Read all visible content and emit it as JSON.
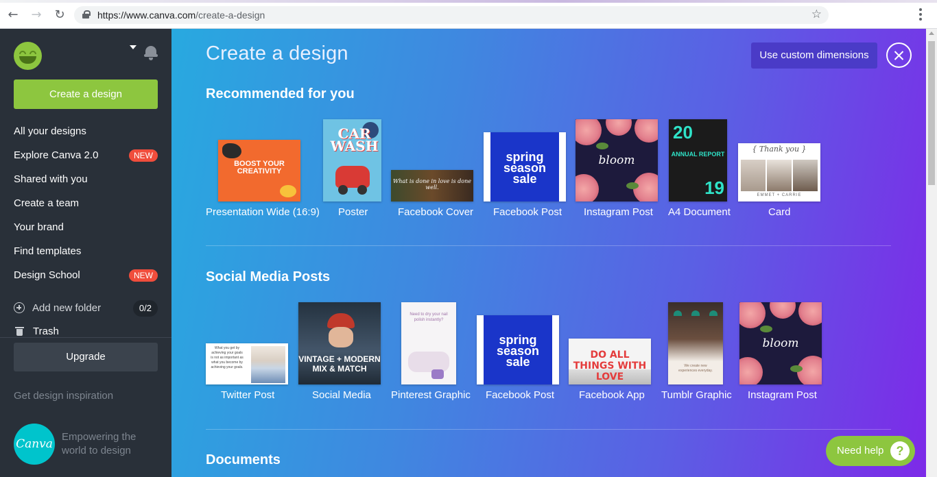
{
  "browser": {
    "url_host": "https://www.canva.com",
    "url_path": "/create-a-design",
    "back_icon": "arrow-left-icon",
    "forward_icon": "arrow-right-icon",
    "reload_icon": "reload-icon"
  },
  "sidebar": {
    "create_label": "Create a design",
    "items": [
      {
        "label": "All your designs"
      },
      {
        "label": "Explore Canva 2.0",
        "badge": "NEW"
      },
      {
        "label": "Shared with you"
      },
      {
        "label": "Create a team"
      },
      {
        "label": "Your brand"
      },
      {
        "label": "Find templates"
      },
      {
        "label": "Design School",
        "badge": "NEW"
      }
    ],
    "add_folder_label": "Add new folder",
    "folder_count": "0/2",
    "trash_label": "Trash",
    "upgrade_label": "Upgrade",
    "inspiration_label": "Get design inspiration",
    "logo_text": "Canva",
    "tagline": "Empowering the world to design"
  },
  "main": {
    "title": "Create a design",
    "custom_dimensions_label": "Use custom dimensions",
    "sections": [
      {
        "title": "Recommended for you",
        "items": [
          {
            "label": "Presentation Wide (16:9)",
            "art": "BOOST YOUR CREATIVITY"
          },
          {
            "label": "Poster",
            "art": "CAR WASH"
          },
          {
            "label": "Facebook Cover",
            "art": "What is done in love is done well."
          },
          {
            "label": "Facebook Post",
            "art": "spring season sale"
          },
          {
            "label": "Instagram Post",
            "art": "bloom"
          },
          {
            "label": "A4 Document",
            "art_top": "20",
            "art_mid": "ANNUAL REPORT",
            "art_bottom": "19"
          },
          {
            "label": "Card",
            "art": "{ Thank you }",
            "art_names": "EMMET + CARRIE"
          }
        ]
      },
      {
        "title": "Social Media Posts",
        "items": [
          {
            "label": "Twitter Post",
            "art": "What you get by achieving your goals is not as important as what you become by achieving your goals."
          },
          {
            "label": "Social Media",
            "art": "VINTAGE + MODERN MIX & MATCH"
          },
          {
            "label": "Pinterest Graphic",
            "art": "Need to dry your nail polish instantly?"
          },
          {
            "label": "Facebook Post",
            "art": "spring season sale"
          },
          {
            "label": "Facebook App",
            "art": "DO ALL THINGS WITH LOVE"
          },
          {
            "label": "Tumblr Graphic",
            "art": "We create new experiences everyday."
          },
          {
            "label": "Instagram Post",
            "art": "bloom"
          }
        ]
      },
      {
        "title": "Documents"
      }
    ]
  },
  "help": {
    "label": "Need help",
    "icon": "?"
  },
  "colors": {
    "accent_green": "#8dc63f",
    "sidebar_bg": "#293039",
    "badge_red": "#f04d3c",
    "gradient_start": "#28a9e0",
    "gradient_end": "#7d2ae8"
  }
}
